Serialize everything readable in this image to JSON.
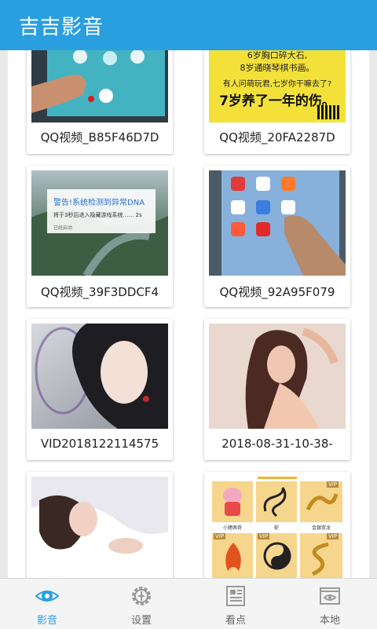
{
  "app": {
    "title": "吉吉影音"
  },
  "videos": [
    {
      "caption": "QQ视频_B85F46D7D"
    },
    {
      "caption": "QQ视频_20FA2287D",
      "overlay": [
        "6岁胸口碎大石,",
        "8岁通晓琴棋书画。",
        "有人问萌玩君,七岁你干嘛去了?",
        "7岁养了一年的伤。"
      ]
    },
    {
      "caption": "QQ视频_39F3DDCF4",
      "overlay": [
        "警告!系统检测到异常DNA",
        "将于3秒后进入隐藏游戏系统…… 2s",
        "已经启动"
      ]
    },
    {
      "caption": "QQ视频_92A95F079"
    },
    {
      "caption": "VID2018122114575"
    },
    {
      "caption": "2018-08-31-10-38-"
    },
    {
      "caption": ""
    },
    {
      "caption": "",
      "overlay": [
        "VIP",
        "VIP",
        "VIP",
        "VIP",
        "VIP",
        "小猪佩奇",
        "蛇",
        "金银双龙"
      ]
    }
  ],
  "nav": [
    {
      "label": "影音",
      "icon": "eye-icon",
      "active": true
    },
    {
      "label": "设置",
      "icon": "gear-icon",
      "active": false
    },
    {
      "label": "看点",
      "icon": "newspaper-icon",
      "active": false
    },
    {
      "label": "本地",
      "icon": "local-folder-icon",
      "active": false
    }
  ],
  "colors": {
    "accent": "#2a9fe0",
    "appbar": "#2a9fe0",
    "nav_bg": "#f4f4f4"
  }
}
